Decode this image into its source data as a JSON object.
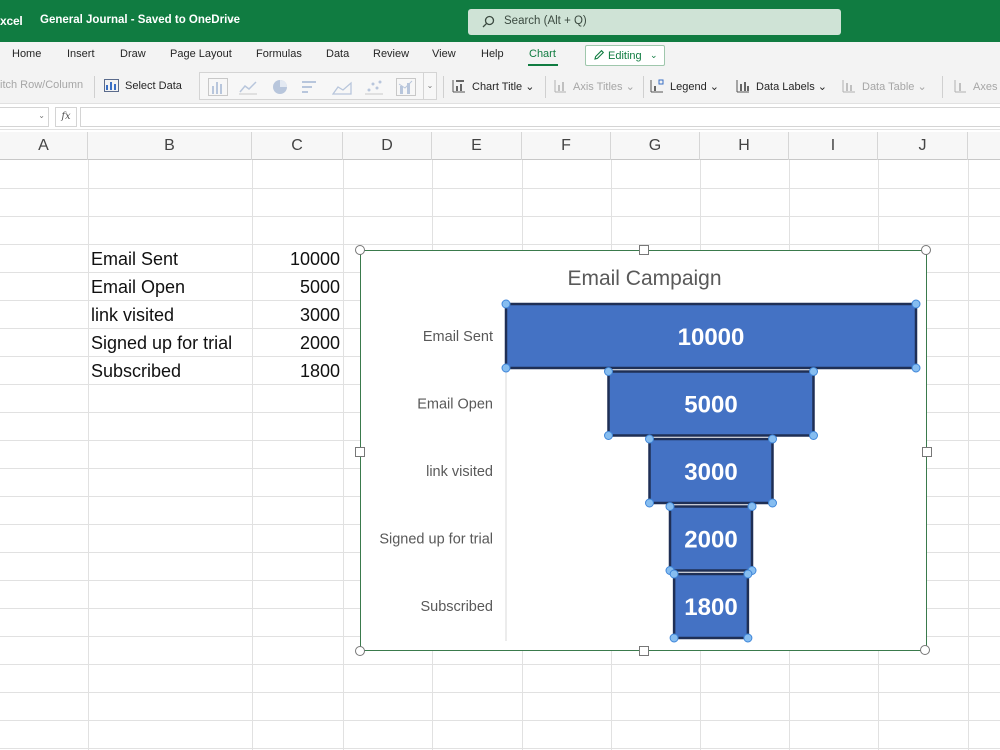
{
  "app": {
    "name": "xcel",
    "document_title": "General Journal",
    "save_status": "Saved to OneDrive",
    "search_placeholder": "Search (Alt + Q)"
  },
  "menu": {
    "items": [
      "Home",
      "Insert",
      "Draw",
      "Page Layout",
      "Formulas",
      "Data",
      "Review",
      "View",
      "Help",
      "Chart"
    ],
    "active": "Chart",
    "editing_label": "Editing"
  },
  "ribbon": {
    "switch_row_column": "itch Row/Column",
    "select_data": "Select Data",
    "chart_title": "Chart Title",
    "axis_titles": "Axis Titles",
    "legend": "Legend",
    "data_labels": "Data Labels",
    "data_table": "Data Table",
    "axes": "Axes"
  },
  "formula_bar": {
    "fx": "fx",
    "content": ""
  },
  "sheet": {
    "columns": [
      "A",
      "B",
      "C",
      "D",
      "E",
      "F",
      "G",
      "H",
      "I",
      "J"
    ],
    "rows": [
      {
        "label": "Email Sent",
        "value": "10000"
      },
      {
        "label": "Email Open",
        "value": "5000"
      },
      {
        "label": "link visited",
        "value": "3000"
      },
      {
        "label": "Signed up for trial",
        "value": "2000"
      },
      {
        "label": "Subscribed",
        "value": "1800"
      }
    ]
  },
  "chart_data": {
    "type": "bar",
    "subtype": "funnel",
    "title": "Email Campaign",
    "categories": [
      "Email Sent",
      "Email Open",
      "link visited",
      "Signed up for trial",
      "Subscribed"
    ],
    "values": [
      10000,
      5000,
      3000,
      2000,
      1800
    ],
    "data_labels": [
      "10000",
      "5000",
      "3000",
      "2000",
      "1800"
    ],
    "bar_color": "#4472c4",
    "selected": true,
    "legend": "none",
    "grid": false
  }
}
